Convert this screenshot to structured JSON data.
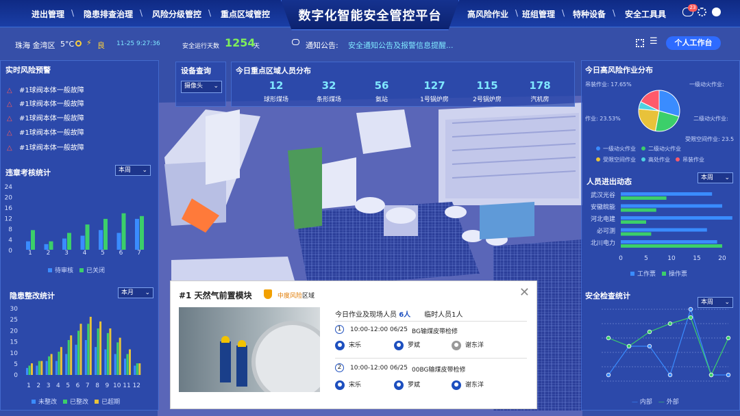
{
  "nav": {
    "left": [
      "进出管理",
      "隐患排查治理",
      "风险分级管控",
      "重点区域管控"
    ],
    "right": [
      "高风险作业",
      "班组管理",
      "特种设备",
      "安全工具具"
    ],
    "title": "数字化智能安全管控平台",
    "badge": "23"
  },
  "sub": {
    "location": "珠海 金湾区",
    "temp": "5°C",
    "aqi": "良",
    "datetime": "11-25 9:27:36",
    "days_label": "安全运行天数",
    "days": "1254",
    "days_unit": "天",
    "notice_label": "通知公告:",
    "notice": "安全通知公告及报警信息提醒...",
    "workspace": "个人工作台"
  },
  "warning": {
    "title": "实时风险预警",
    "items": [
      "#1球阀本体一般故障",
      "#1球阀本体一般故障",
      "#1球阀本体一般故障",
      "#1球阀本体一般故障",
      "#1球阀本体一般故障"
    ]
  },
  "violation": {
    "title": "违章考核统计",
    "period": "本周",
    "yticks": [
      "24",
      "20",
      "16",
      "12",
      "8",
      "4",
      "0"
    ],
    "xticks": [
      "1",
      "2",
      "3",
      "4",
      "5",
      "6",
      "7"
    ],
    "legend": [
      "待审核",
      "已关闭"
    ],
    "colors": [
      "#3a8cff",
      "#3ccf6a"
    ]
  },
  "hazard": {
    "title": "隐患整改统计",
    "period": "本月",
    "yticks": [
      "30",
      "25",
      "20",
      "15",
      "10",
      "5",
      "0"
    ],
    "xticks": [
      "1",
      "2",
      "3",
      "4",
      "5",
      "6",
      "7",
      "8",
      "9",
      "10",
      "11",
      "12"
    ],
    "legend": [
      "未整改",
      "已整改",
      "已超期"
    ],
    "colors": [
      "#3a8cff",
      "#3ccf6a",
      "#e8c23a"
    ]
  },
  "device": {
    "title": "设备查询",
    "value": "摄像头"
  },
  "personnel": {
    "title": "今日重点区域人员分布",
    "stats": [
      {
        "n": "12",
        "l": "球形煤场"
      },
      {
        "n": "32",
        "l": "条形煤场"
      },
      {
        "n": "56",
        "l": "氨站"
      },
      {
        "n": "127",
        "l": "1号锅炉房"
      },
      {
        "n": "115",
        "l": "2号锅炉房"
      },
      {
        "n": "178",
        "l": "汽机房"
      }
    ]
  },
  "highrisk": {
    "title": "今日高风险作业分布",
    "lbl_a": "吊装作业: 17.65%",
    "lbl_b": "一级动火作业:",
    "lbl_c": "作业: 23.53%",
    "lbl_d": "二级动火作业:",
    "lbl_e": "受限空间作业: 23.5",
    "legend": [
      "一级动火作业",
      "二级动火作业",
      "受限空间作业",
      "高处作业",
      "吊装作业"
    ],
    "colors": [
      "#3a8cff",
      "#3ccf6a",
      "#e8c23a",
      "#4fd1e0",
      "#ff5a6a"
    ],
    "values": [
      29.41,
      23.53,
      23.53,
      5.88,
      17.65
    ]
  },
  "flow": {
    "title": "人员进出动态",
    "period": "本周",
    "companies": [
      "武汉光谷",
      "安徽皖能",
      "河北电建",
      "必可测",
      "北川电力"
    ],
    "xticks": [
      "0",
      "5",
      "10",
      "15",
      "20"
    ],
    "legend": [
      "工作票",
      "操作票"
    ]
  },
  "safety": {
    "title": "安全检查统计",
    "period": "本周",
    "legend": [
      "内部",
      "外部"
    ]
  },
  "popup": {
    "title": "#1 天然气前置模块",
    "risk": "中度风险",
    "risk_suffix": "区域",
    "summary_pre": "今日作业及现场人员",
    "count": "6人",
    "temp_label": "临时人员1人",
    "tasks": [
      {
        "idx": "1",
        "time": "10:00-12:00 06/25",
        "name": "BG输煤皮带检修",
        "people": [
          "宋乐",
          "罗斌",
          "谢东洋"
        ]
      },
      {
        "idx": "2",
        "time": "10:00-12:00 06/25",
        "name": "00BG输煤皮带检修",
        "people": [
          "宋乐",
          "罗斌",
          "谢东洋"
        ]
      }
    ]
  }
}
